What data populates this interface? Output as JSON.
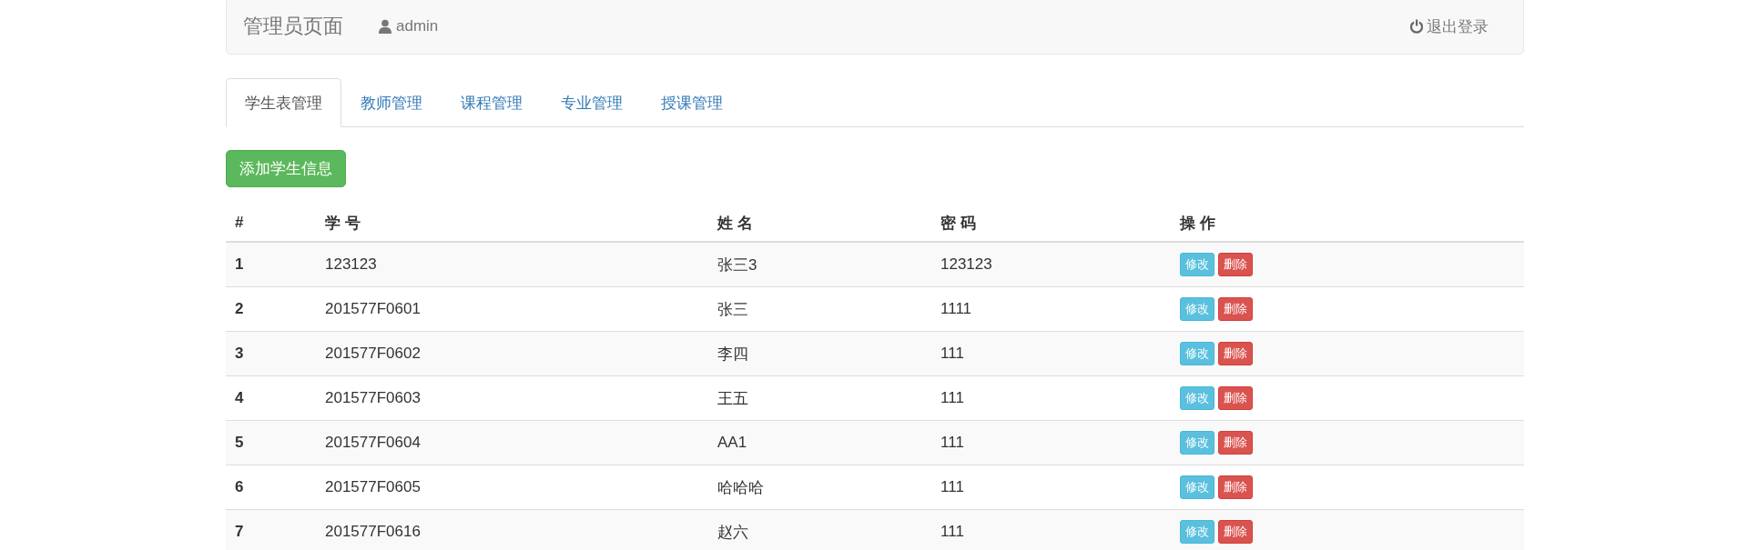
{
  "navbar": {
    "brand": "管理员页面",
    "user": "admin",
    "logout": "退出登录"
  },
  "tabs": [
    {
      "label": "学生表管理",
      "selected": true
    },
    {
      "label": "教师管理",
      "selected": false
    },
    {
      "label": "课程管理",
      "selected": false
    },
    {
      "label": "专业管理",
      "selected": false
    },
    {
      "label": "授课管理",
      "selected": false
    }
  ],
  "add_button": "添加学生信息",
  "table": {
    "columns": [
      "#",
      "学 号",
      "姓 名",
      "密 码",
      "操 作"
    ],
    "rows": [
      {
        "index": "1",
        "id": "123123",
        "name": "张三3",
        "password": "123123",
        "actions": [
          "修改",
          "删除"
        ]
      },
      {
        "index": "2",
        "id": "201577F0601",
        "name": "张三",
        "password": "1111",
        "actions": [
          "修改",
          "删除"
        ]
      },
      {
        "index": "3",
        "id": "201577F0602",
        "name": "李四",
        "password": "111",
        "actions": [
          "修改",
          "删除"
        ]
      },
      {
        "index": "4",
        "id": "201577F0603",
        "name": "王五",
        "password": "111",
        "actions": [
          "修改",
          "删除"
        ]
      },
      {
        "index": "5",
        "id": "201577F0604",
        "name": "AA1",
        "password": "111",
        "actions": [
          "修改",
          "删除"
        ]
      },
      {
        "index": "6",
        "id": "201577F0605",
        "name": "哈哈哈",
        "password": "111",
        "actions": [
          "修改",
          "删除"
        ]
      },
      {
        "index": "7",
        "id": "201577F0616",
        "name": "赵六",
        "password": "111",
        "actions": [
          "修改",
          "删除"
        ]
      }
    ]
  }
}
